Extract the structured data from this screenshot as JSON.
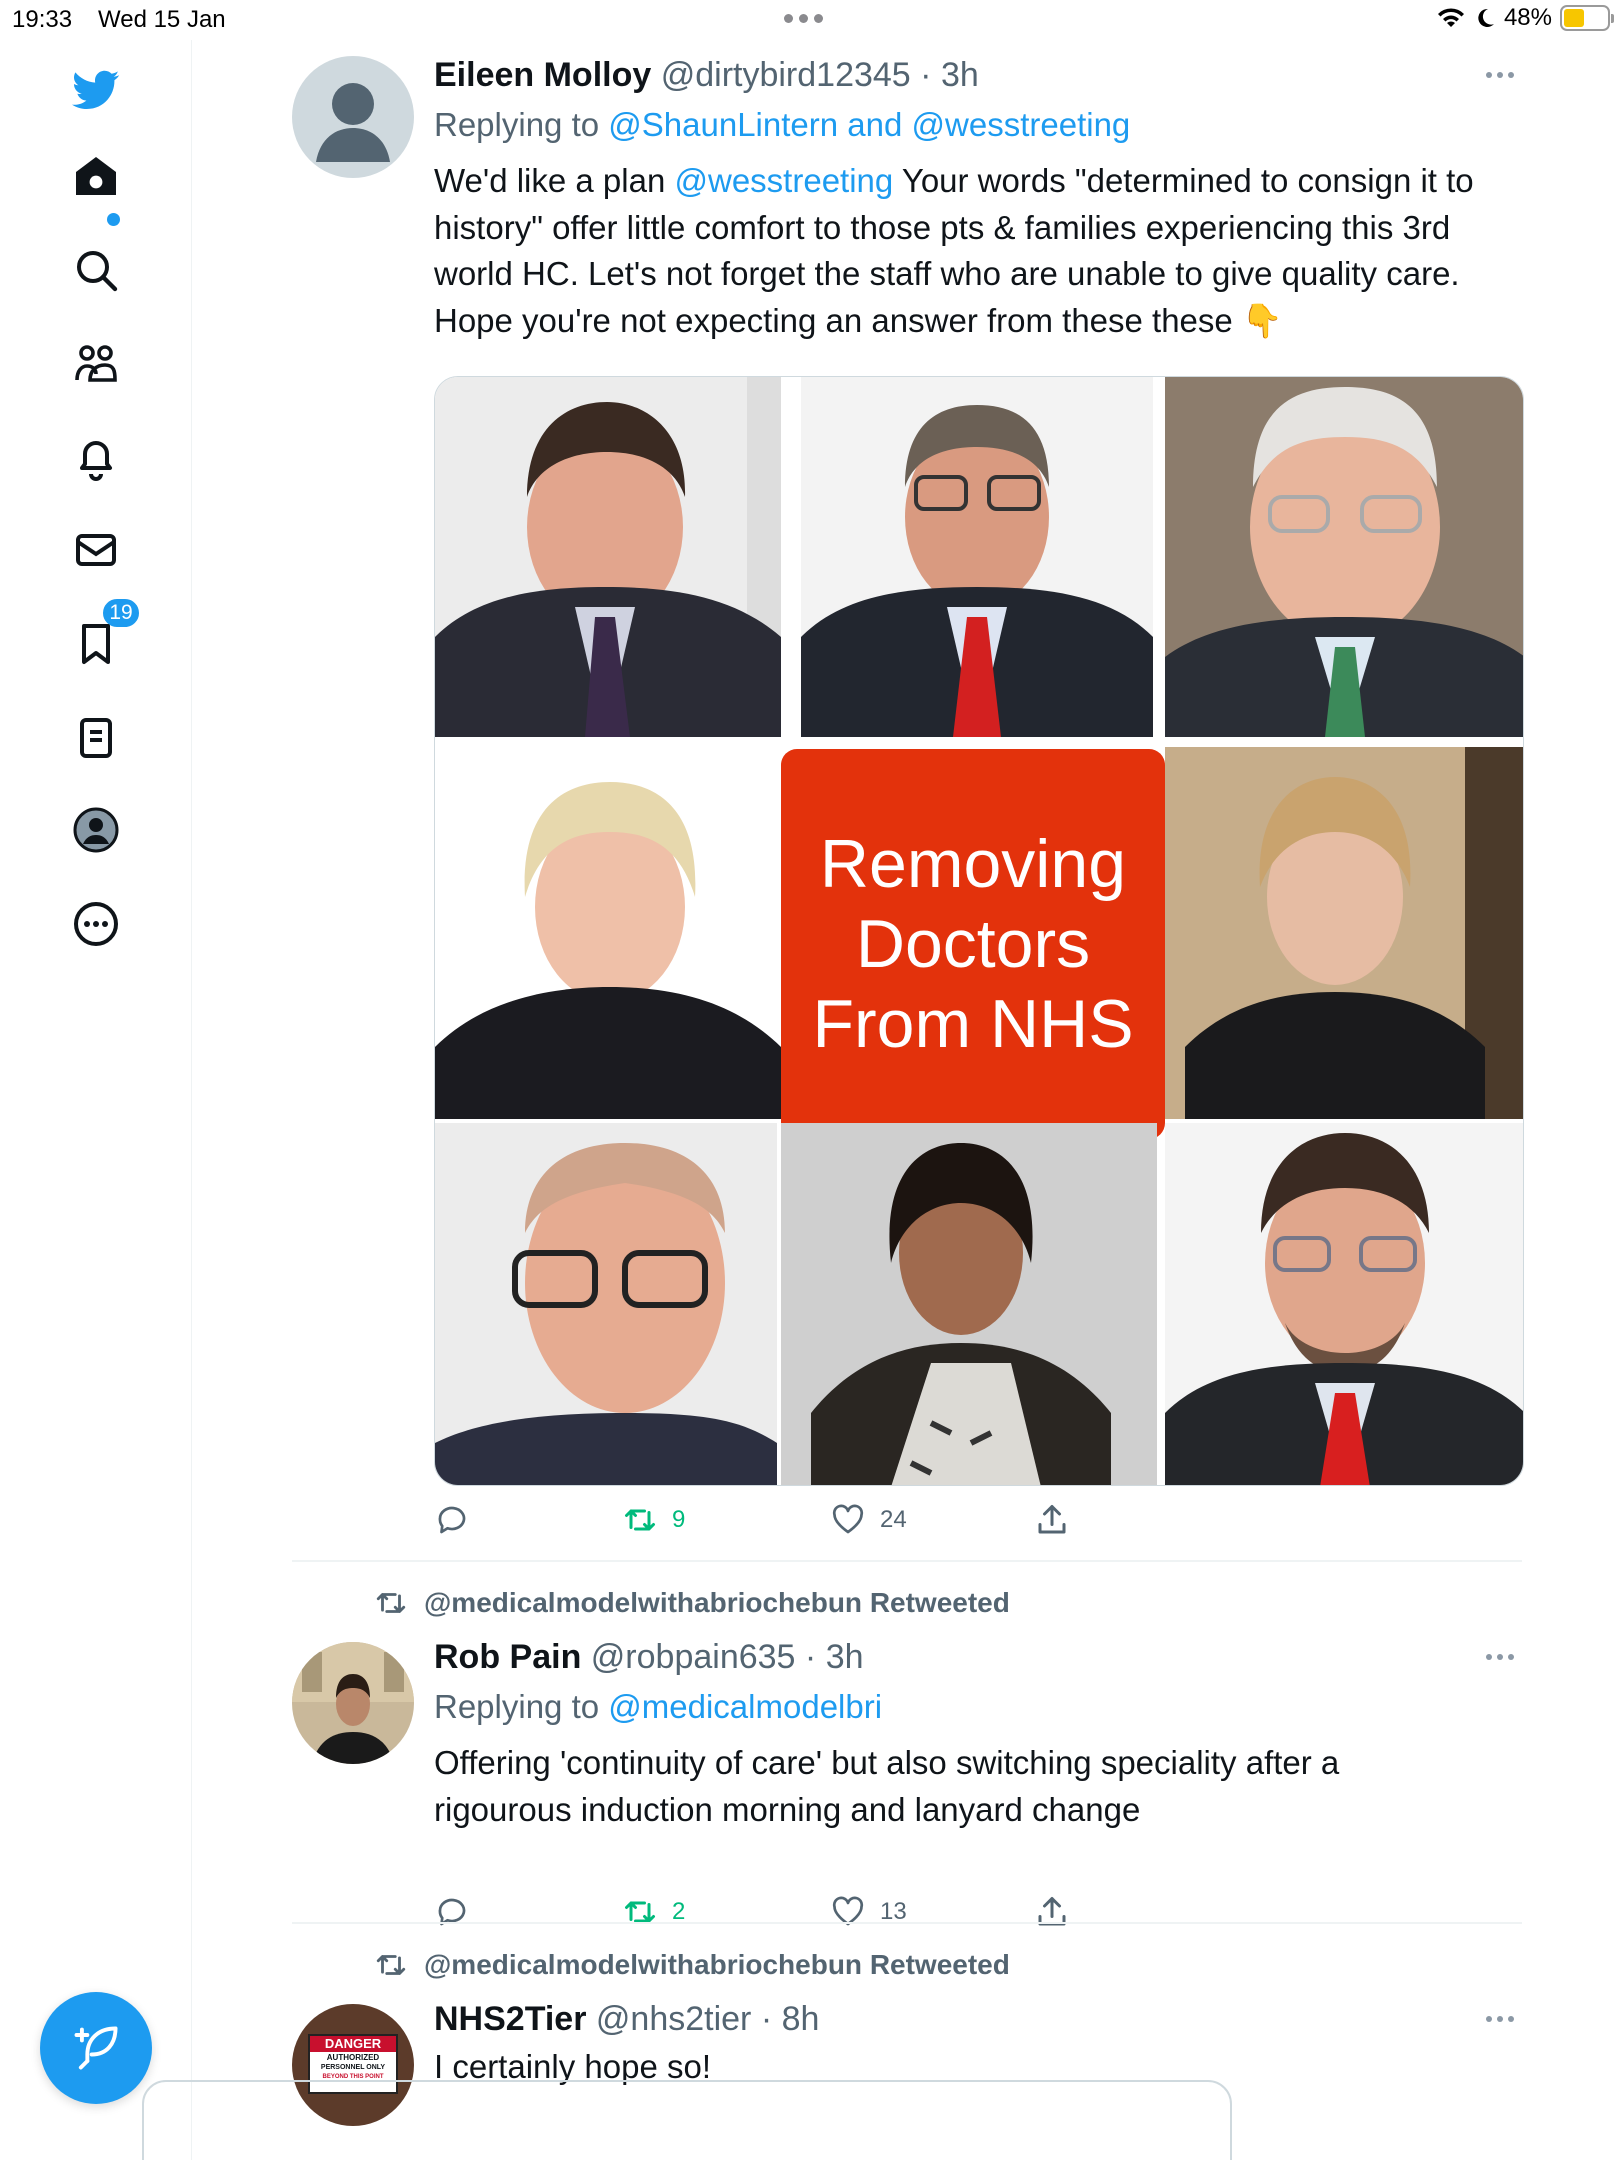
{
  "status_bar": {
    "time": "19:33",
    "date": "Wed 15 Jan",
    "battery_text": "48%",
    "battery_level": 0.48,
    "battery_color": "#f7c600"
  },
  "sidebar": {
    "items": [
      "twitter-logo",
      "home",
      "search",
      "communities",
      "notifications",
      "messages",
      "bookmarks",
      "lists",
      "profile",
      "more"
    ],
    "notification_badge": "19",
    "accent_color": "#1d9bf0"
  },
  "tweets": [
    {
      "name": "Eileen Molloy",
      "handle": "@dirtybird12345",
      "sep": "·",
      "time": "3h",
      "reply_prefix": "Replying to",
      "reply_to_1": "@ShaunLintern",
      "reply_and": "and",
      "reply_to_2": "@wesstreeting",
      "text": {
        "l1a": "We'd like a plan ",
        "l1m": "@wesstreeting",
        "l1b": " Your words \"determined to consign it to",
        "l2": "history\" offer little comfort to those pts & families experiencing this 3rd",
        "l3": "world HC. Let's not forget the staff who are unable to give quality care.",
        "l4": "Hope you're  not expecting an answer from these these 👇"
      },
      "media_caption": [
        "Removing",
        "Doctors",
        "From NHS"
      ],
      "retweets": "9",
      "likes": "24"
    },
    {
      "retweeted_by": "@medicalmodelwithabriochebun Retweeted",
      "name": "Rob Pain",
      "handle": "@robpain635",
      "sep": "·",
      "time": "3h",
      "reply_prefix": "Replying to",
      "reply_to_1": "@medicalmodelbri",
      "text": {
        "l1": "Offering 'continuity of care' but also switching speciality after a",
        "l2": "rigourous induction morning and lanyard change"
      },
      "retweets": "2",
      "likes": "13"
    },
    {
      "retweeted_by": "@medicalmodelwithabriochebun Retweeted",
      "name": "NHS2Tier",
      "handle": "@nhs2tier",
      "sep": "·",
      "time": "8h",
      "text": {
        "l1": "I certainly hope so!"
      },
      "sign": {
        "title": "DANGER",
        "l1": "AUTHORIZED",
        "l2": "PERSONNEL ONLY",
        "l3": "BEYOND THIS POINT"
      }
    }
  ]
}
